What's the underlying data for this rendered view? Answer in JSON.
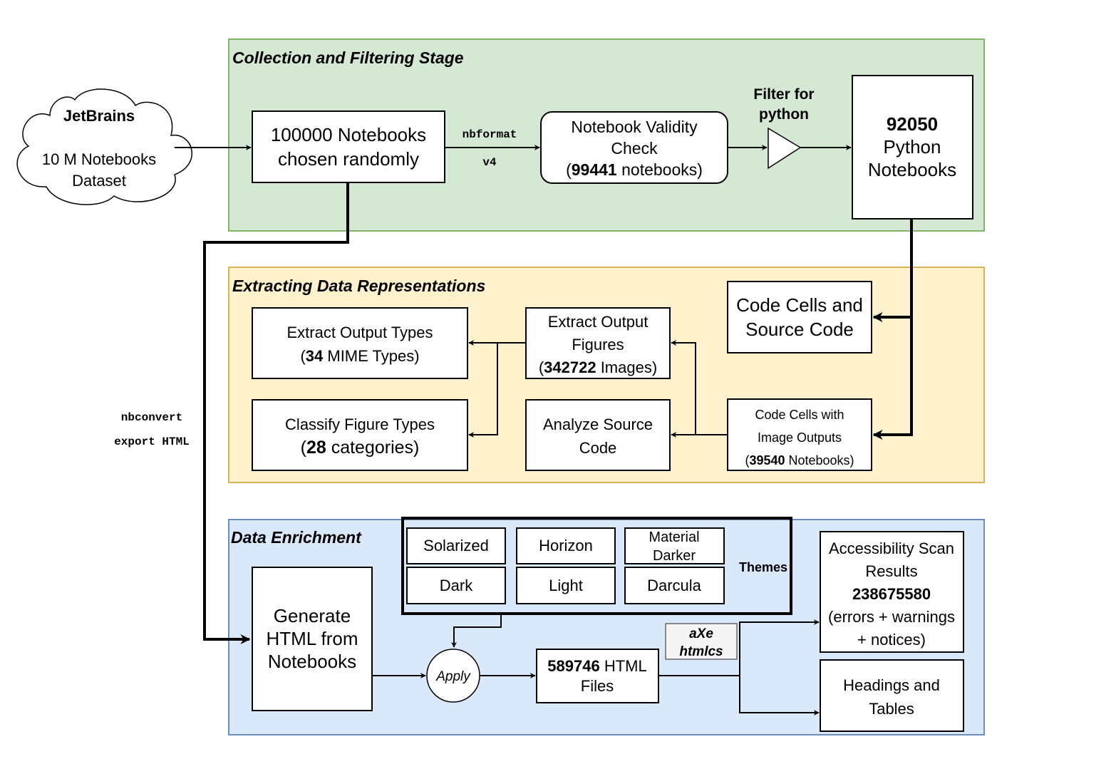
{
  "colors": {
    "collection_bg": "#d5e8d4",
    "collection_border": "#82b366",
    "extracting_bg": "#fff2cc",
    "extracting_border": "#d6b656",
    "enrichment_bg": "#dae8fc",
    "enrichment_border": "#6c8ebf",
    "tool_tag_bg": "#f5f5f5",
    "tool_tag_border": "#666666"
  },
  "source": {
    "title": "JetBrains",
    "line1": "10 M Notebooks",
    "line2": "Dataset"
  },
  "stages": {
    "collection": {
      "title": "Collection and Filtering Stage",
      "random_sample": {
        "line1": "100000 Notebooks",
        "line2": "chosen randomly"
      },
      "edge_label": {
        "line1": "nbformat",
        "line2": "v4"
      },
      "validity": {
        "line1": "Notebook Validity",
        "line2": "Check",
        "count": "99441",
        "suffix": " notebooks)",
        "prefix": "("
      },
      "filter": {
        "line1": "Filter for",
        "line2": "python"
      },
      "python": {
        "count": "92050",
        "line1": "Python",
        "line2": "Notebooks"
      }
    },
    "extracting": {
      "title": "Extracting Data Representations",
      "output_types": {
        "line1": "Extract Output Types",
        "prefix": "(",
        "count": "34",
        "suffix": " MIME Types)"
      },
      "classify": {
        "line1": "Classify Figure Types",
        "prefix": "(",
        "count": "28",
        "suffix": " categories)"
      },
      "figures": {
        "line1": "Extract Output",
        "line2": "Figures",
        "prefix": "(",
        "count": "342722",
        "suffix": " Images)"
      },
      "analyze": {
        "line1": "Analyze Source",
        "line2": "Code"
      },
      "code_cells": {
        "line1": "Code Cells and",
        "line2": "Source Code"
      },
      "image_cells": {
        "line1": "Code Cells with",
        "line2": "Image Outputs",
        "prefix": "(",
        "count": "39540",
        "suffix": " Notebooks)"
      }
    },
    "enrichment": {
      "title": "Data Enrichment",
      "side_label": {
        "line1": "nbconvert",
        "line2": "export HTML"
      },
      "generate": {
        "line1": "Generate",
        "line2": "HTML from",
        "line3": "Notebooks"
      },
      "themes_label": "Themes",
      "themes": [
        {
          "label": "Solarized"
        },
        {
          "label": "Horizon"
        },
        {
          "label": "Material",
          "label2": "Darker"
        },
        {
          "label": "Dark"
        },
        {
          "label": "Light"
        },
        {
          "label": "Darcula"
        }
      ],
      "apply": "Apply",
      "html_files": {
        "count": "589746",
        "suffix": " HTML",
        "line2": "Files"
      },
      "tools": {
        "line1": "aXe",
        "line2": "htmlcs"
      },
      "scan": {
        "line1": "Accessibility Scan",
        "line2": "Results",
        "count": "238675580",
        "line3": "(errors + warnings",
        "line4": "+ notices)"
      },
      "headings": {
        "line1": "Headings and",
        "line2": "Tables"
      }
    }
  }
}
